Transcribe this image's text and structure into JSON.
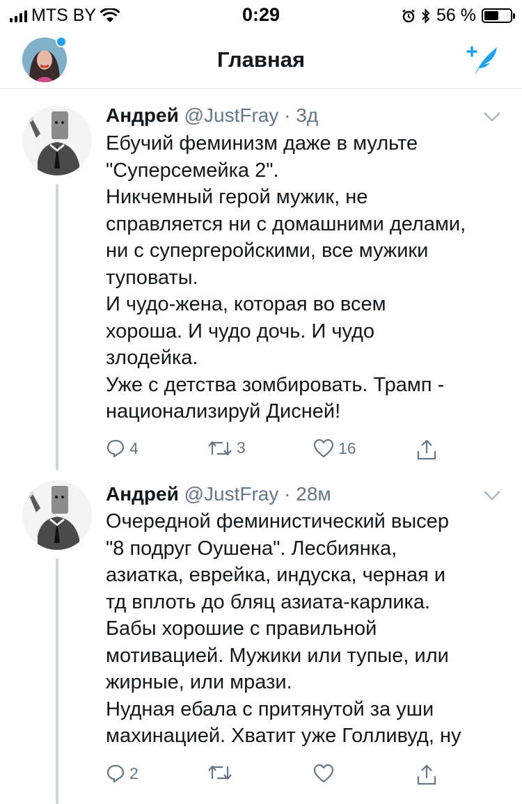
{
  "status_bar": {
    "carrier": "MTS BY",
    "time": "0:29",
    "battery_percent": "56 %",
    "battery_level": 0.56
  },
  "nav": {
    "title": "Главная",
    "avatar_icon": "profile-avatar",
    "compose_icon": "compose-tweet-icon",
    "accent_color": "#1da1f2"
  },
  "tweets": [
    {
      "name": "Андрей",
      "handle": "@JustFray",
      "time": "3д",
      "lines": [
        "Ебучий феминизм даже в мульте",
        "\"Суперсемейка 2\".",
        "Никчемный герой мужик, не",
        "справляется ни с домашними делами,",
        "ни с супергеройскими, все мужики",
        "туповаты.",
        "И чудо-жена, которая во всем",
        "хороша. И чудо дочь. И чудо",
        "злодейка.",
        "Уже с детства зомбировать. Трамп -",
        "национализируй Дисней!"
      ],
      "replies": "4",
      "retweets": "3",
      "likes": "16"
    },
    {
      "name": "Андрей",
      "handle": "@JustFray",
      "time": "28м",
      "lines": [
        "Очередной феминистический высер",
        "\"8 подруг Оушена\". Лесбиянка,",
        "азиатка, еврейка, индуска, черная и",
        "тд вплоть до бляц азиата-карлика.",
        "Бабы хорошие с правильной",
        "мотивацией. Мужики или тупые, или",
        "жирные, или мрази.",
        "Нудная ебала с притянутой за уши",
        "махинацией. Хватит уже Голливуд, ну"
      ],
      "replies": "2",
      "retweets": "",
      "likes": ""
    }
  ]
}
